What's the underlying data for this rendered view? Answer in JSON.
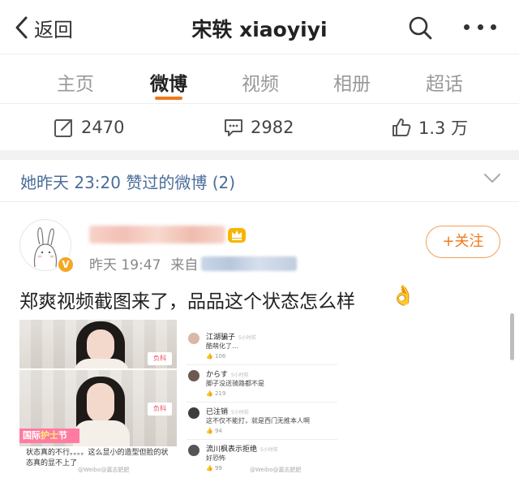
{
  "nav": {
    "back_label": "返回",
    "title": "宋轶 xiaoyiyi",
    "icons": [
      "back-chevron-icon",
      "search-icon",
      "more-icon"
    ]
  },
  "tabs": [
    {
      "label": "主页",
      "active": false
    },
    {
      "label": "微博",
      "active": true
    },
    {
      "label": "视频",
      "active": false
    },
    {
      "label": "相册",
      "active": false
    },
    {
      "label": "超话",
      "active": false
    }
  ],
  "stats": {
    "repost": "2470",
    "comment": "2982",
    "like": "1.3 万"
  },
  "liked_header": {
    "text": "她昨天 23:20 赞过的微博 (2)"
  },
  "post": {
    "time": "昨天 19:47",
    "source_prefix": "来自",
    "follow_label": "+关注",
    "text": "郑爽视频截图来了，品品这个状态怎么样",
    "emoji": "👌",
    "image_left": {
      "banner": [
        "国际",
        "护士",
        "节"
      ],
      "tag": "负科",
      "caption": "状态真的不行。。。。这么显小的造型但脸的状态真的显不上了",
      "watermark": "@Weibo@嘉志肥肥"
    },
    "image_right": {
      "comments": [
        {
          "name": "江湖骗子",
          "time": "5小时前",
          "content": "酷萌化了…",
          "likes": "106"
        },
        {
          "name": "からす",
          "time": "5小时前",
          "content": "脚子没送骑路都不是",
          "likes": "219"
        },
        {
          "name": "已注销",
          "time": "5小时前",
          "content": "这不仅不能打，就是西门无推本人啊",
          "likes": "94"
        },
        {
          "name": "流川枫表示拒绝",
          "time": "5小时前",
          "content": "好恐怖",
          "likes": "99"
        }
      ],
      "watermark": "@Weibo@嘉志肥肥"
    }
  },
  "colors": {
    "accent": "#f07a1d",
    "link_blue": "#4a6d99",
    "text": "#222222",
    "muted": "#999999"
  }
}
